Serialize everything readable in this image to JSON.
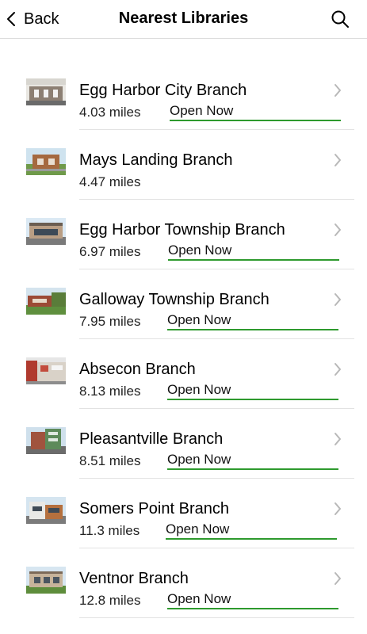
{
  "nav": {
    "back_label": "Back",
    "title": "Nearest Libraries",
    "back_icon": "chevron-left-icon",
    "search_icon": "search-icon"
  },
  "status_color": "#2e9a2e",
  "libraries": [
    {
      "name": "Egg Harbor City Branch",
      "distance": "4.03 miles",
      "status": "Open Now"
    },
    {
      "name": "Mays Landing Branch",
      "distance": "4.47 miles",
      "status": ""
    },
    {
      "name": "Egg Harbor Township Branch",
      "distance": "6.97 miles",
      "status": "Open Now"
    },
    {
      "name": "Galloway Township Branch",
      "distance": "7.95 miles",
      "status": "Open Now"
    },
    {
      "name": "Absecon Branch",
      "distance": "8.13 miles",
      "status": "Open Now"
    },
    {
      "name": "Pleasantville Branch",
      "distance": "8.51 miles",
      "status": "Open Now"
    },
    {
      "name": "Somers Point Branch",
      "distance": "11.3 miles",
      "status": "Open Now"
    },
    {
      "name": "Ventnor Branch",
      "distance": "12.8 miles",
      "status": "Open Now"
    }
  ]
}
